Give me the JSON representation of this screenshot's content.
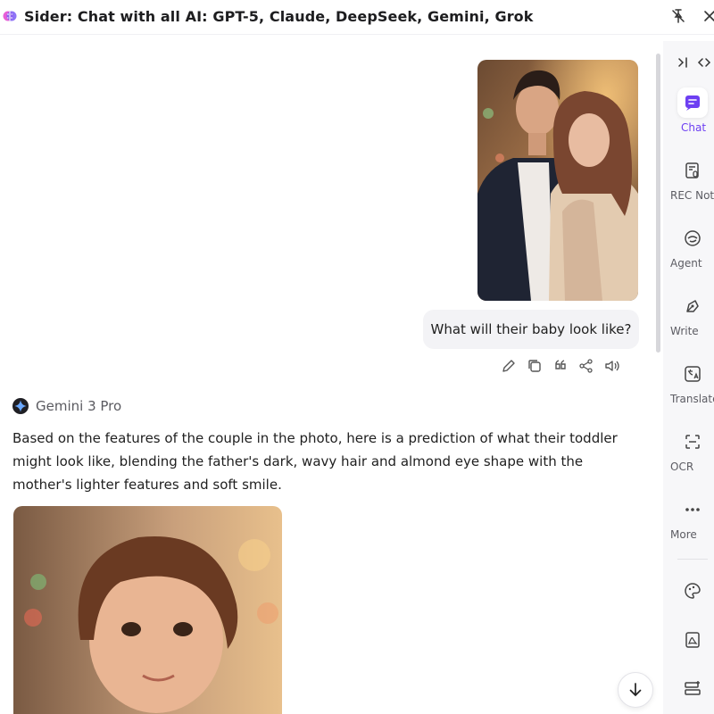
{
  "window": {
    "title": "Sider: Chat with all AI: GPT-5, Claude, DeepSeek, Gemini, Grok"
  },
  "conversation": {
    "user_message": "What will their baby look like?",
    "model_name": "Gemini 3 Pro",
    "answer_text": "Based on the features of the couple in the photo, here is a prediction of what their toddler might look like, blending the father's dark, wavy hair and almond eye shape with the mother's lighter features and soft smile."
  },
  "message_actions": [
    "edit-icon",
    "copy-icon",
    "quote-icon",
    "share-icon",
    "speaker-icon"
  ],
  "sidebar": {
    "items": [
      {
        "label": "Chat",
        "icon": "chat-icon",
        "active": true
      },
      {
        "label": "REC Note",
        "icon": "rec-note-icon",
        "active": false
      },
      {
        "label": "Agent",
        "icon": "agent-icon",
        "active": false
      },
      {
        "label": "Write",
        "icon": "write-icon",
        "active": false
      },
      {
        "label": "Translate",
        "icon": "translate-icon",
        "active": false
      },
      {
        "label": "OCR",
        "icon": "ocr-icon",
        "active": false
      },
      {
        "label": "More",
        "icon": "more-icon",
        "active": false
      }
    ],
    "tools": [
      "palette-icon",
      "pdf-icon",
      "layout-add-icon"
    ]
  },
  "colors": {
    "accent": "#6d3ff2",
    "sidebar_bg": "#f7f7f9",
    "bubble_bg": "#f3f3f6"
  }
}
